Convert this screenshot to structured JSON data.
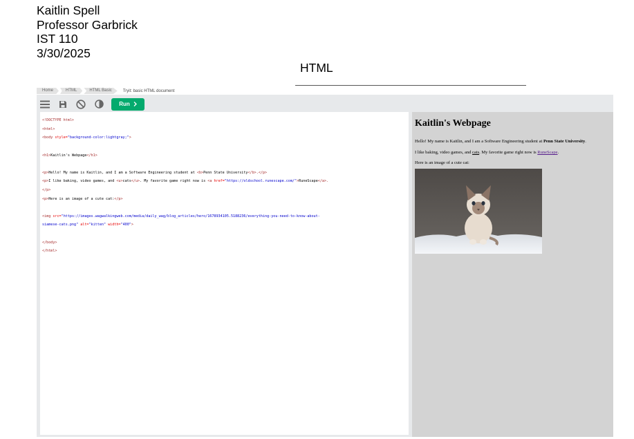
{
  "doc": {
    "name": "Kaitlin Spell",
    "professor": "Professor Garbrick",
    "course": "IST 110",
    "date": "3/30/2025",
    "section_title": "HTML"
  },
  "breadcrumbs": [
    "Home",
    "HTML",
    "HTML Basic",
    "Tryit: basic HTML document"
  ],
  "toolbar": {
    "menu_icon": "hamburger-icon",
    "save_icon": "save-icon",
    "clear_icon": "no-entry-icon",
    "theme_icon": "contrast-icon",
    "run_label": "Run",
    "run_color": "#04aa6d"
  },
  "code": {
    "l1": "<!DOCTYPE html>",
    "l2": "<html>",
    "l3_tag": "<body ",
    "l3_attr": "style=",
    "l3_val": "\"background-color:lightgray;\"",
    "l3_end": ">",
    "l5_open": "<h1>",
    "l5_text": "Kaitlin's Webpage",
    "l5_close": "</h1>",
    "l7_open": "<p>",
    "l7_text": "Hello! My name is Kaitlin, and I am a Software Engineering student at ",
    "l7_b": "<b>",
    "l7_btext": "Penn State University",
    "l7_bclose": "</b>.",
    "l7_close": "</p>",
    "l8_open": "<p>",
    "l8_text1": "I like baking, video games, and ",
    "l8_u": "<u>",
    "l8_utext": "cats",
    "l8_uclose": "</u>",
    "l8_text2": ". My favorite game right now is ",
    "l8_a": "<a ",
    "l8_href": "href=",
    "l8_hrefval": "\"https://oldschool.runescape.com/\"",
    "l8_aend": ">",
    "l8_atext": "RuneScape",
    "l8_aclose": "</a>.",
    "l9_close": "</p>",
    "l10_open": "<p>",
    "l10_text": "Here is an image of a cute cat:",
    "l10_close": "</p>",
    "l12_tag": "<img ",
    "l12_src": "src=",
    "l12_srcval": "\"https://images.wagwalkingweb.com/media/daily_wag/blog_articles/hero/1678934105.5188236/everything-you-need-to-know-about-",
    "l13_srcval": "siamese-cats.png\"",
    "l13_alt": " alt=",
    "l13_altval": "\"kitten\"",
    "l13_width": " width=",
    "l13_widthval": "\"400\"",
    "l13_end": ">",
    "l15": "</body>",
    "l16": "</html>"
  },
  "result": {
    "title": "Kaitlin's Webpage",
    "p1_text": "Hello! My name is Kaitlin, and I am a Software Engineering student at ",
    "p1_bold": "Penn State University",
    "p1_end": ".",
    "p2_text1": "I like baking, video games, and ",
    "p2_underline": "cats",
    "p2_text2": ". My favorite game right now is ",
    "p2_link": "RuneScape",
    "p2_end": ".",
    "p3_text": "Here is an image of a cute cat:",
    "image_alt": "kitten",
    "background": "#d3d3d3"
  }
}
